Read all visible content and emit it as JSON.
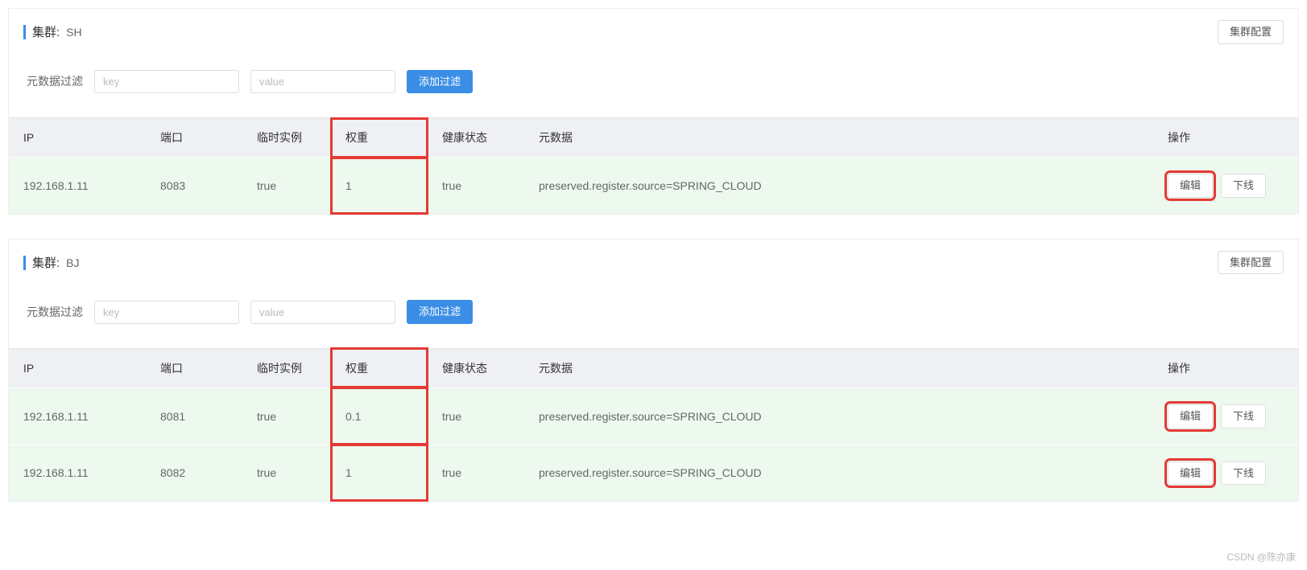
{
  "labels": {
    "cluster_prefix": "集群:",
    "cluster_config_btn": "集群配置",
    "filter_label": "元数据过滤",
    "key_placeholder": "key",
    "value_placeholder": "value",
    "add_filter_btn": "添加过滤",
    "edit_btn": "编辑",
    "offline_btn": "下线"
  },
  "columns": {
    "ip": "IP",
    "port": "端口",
    "ephemeral": "临时实例",
    "weight": "权重",
    "health": "健康状态",
    "metadata": "元数据",
    "op": "操作"
  },
  "clusters": [
    {
      "name": "SH",
      "rows": [
        {
          "ip": "192.168.1.11",
          "port": "8083",
          "ephemeral": "true",
          "weight": "1",
          "health": "true",
          "metadata": "preserved.register.source=SPRING_CLOUD"
        }
      ]
    },
    {
      "name": "BJ",
      "rows": [
        {
          "ip": "192.168.1.11",
          "port": "8081",
          "ephemeral": "true",
          "weight": "0.1",
          "health": "true",
          "metadata": "preserved.register.source=SPRING_CLOUD"
        },
        {
          "ip": "192.168.1.11",
          "port": "8082",
          "ephemeral": "true",
          "weight": "1",
          "health": "true",
          "metadata": "preserved.register.source=SPRING_CLOUD"
        }
      ]
    }
  ],
  "watermark": "CSDN @陈亦康"
}
